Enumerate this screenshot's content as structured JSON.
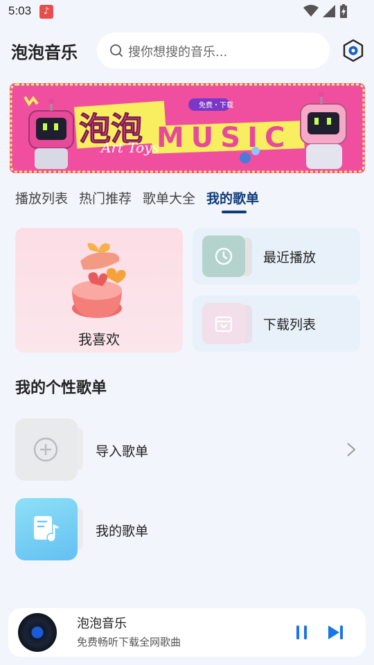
{
  "status": {
    "time": "5:03",
    "app_icon": "music-note-icon"
  },
  "header": {
    "title": "泡泡音乐",
    "search_placeholder": "搜你想搜的音乐..."
  },
  "banner": {
    "main_text_cn": "泡泡",
    "main_text_en": "MUSIC",
    "tag": "免费・下载",
    "sub_text": "Art Toys"
  },
  "tabs": [
    {
      "label": "播放列表",
      "active": false
    },
    {
      "label": "热门推荐",
      "active": false
    },
    {
      "label": "歌单大全",
      "active": false
    },
    {
      "label": "我的歌单",
      "active": true
    }
  ],
  "cards": {
    "favorite": {
      "label": "我喜欢",
      "icon": "gift-heart-icon"
    },
    "recent": {
      "label": "最近播放",
      "icon": "clock-icon"
    },
    "download": {
      "label": "下载列表",
      "icon": "download-box-icon"
    }
  },
  "section": {
    "title": "我的个性歌单"
  },
  "playlists": [
    {
      "label": "导入歌单",
      "icon": "plus-circle-icon"
    },
    {
      "label": "我的歌单",
      "icon": "music-note-doc-icon"
    }
  ],
  "player": {
    "title": "泡泡音乐",
    "subtitle": "免费畅听下载全网歌曲"
  },
  "colors": {
    "accent": "#0f3a78",
    "banner_bg": "#f04fa0",
    "banner_yellow": "#f7ef5f",
    "play_blue": "#1a73e8"
  }
}
